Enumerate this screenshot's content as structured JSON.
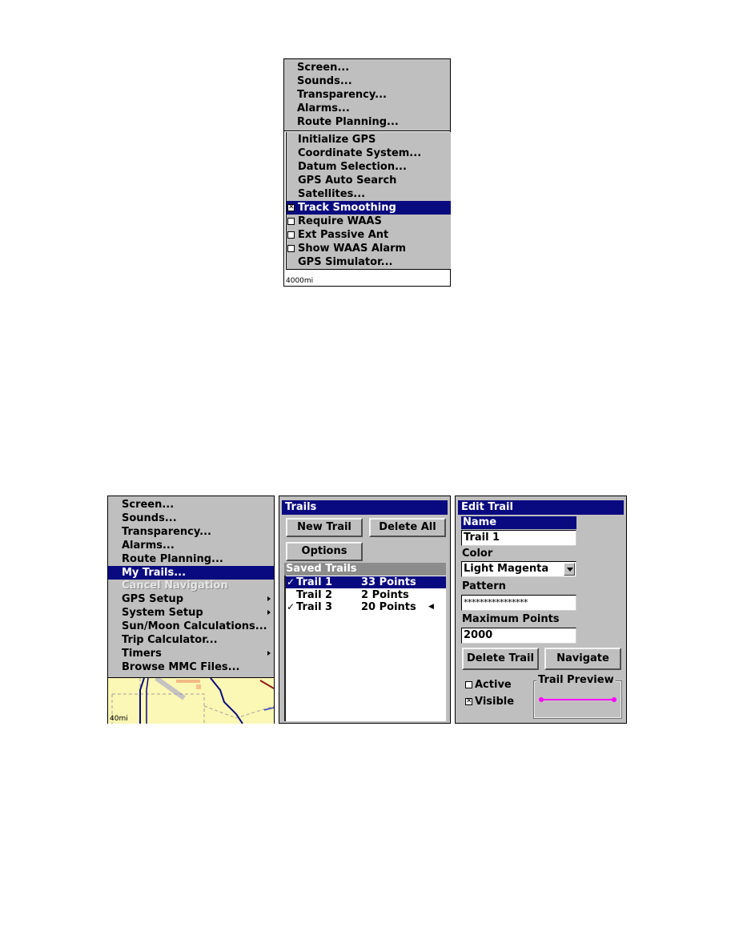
{
  "top_menu": {
    "items_group1": [
      {
        "label": "Screen..."
      },
      {
        "label": "Sounds..."
      },
      {
        "label": "Transparency..."
      },
      {
        "label": "Alarms..."
      },
      {
        "label": "Route Planning..."
      }
    ],
    "items_group2": [
      {
        "label": "Initialize GPS",
        "checkbox": null,
        "selected": false
      },
      {
        "label": "Coordinate System...",
        "checkbox": null,
        "selected": false
      },
      {
        "label": "Datum Selection...",
        "checkbox": null,
        "selected": false
      },
      {
        "label": "GPS Auto Search",
        "checkbox": null,
        "selected": false
      },
      {
        "label": "Satellites...",
        "checkbox": null,
        "selected": false
      },
      {
        "label": "Track Smoothing",
        "checkbox": true,
        "selected": true
      },
      {
        "label": "Require WAAS",
        "checkbox": false,
        "selected": false
      },
      {
        "label": "Ext Passive Ant",
        "checkbox": false,
        "selected": false
      },
      {
        "label": "Show WAAS Alarm",
        "checkbox": false,
        "selected": false
      },
      {
        "label": "GPS Simulator...",
        "checkbox": null,
        "selected": false
      }
    ],
    "scale": "4000mi"
  },
  "main_menu": {
    "items": [
      {
        "label": "Screen...",
        "selected": false,
        "disabled": false,
        "submenu": false
      },
      {
        "label": "Sounds...",
        "selected": false,
        "disabled": false,
        "submenu": false
      },
      {
        "label": "Transparency...",
        "selected": false,
        "disabled": false,
        "submenu": false
      },
      {
        "label": "Alarms...",
        "selected": false,
        "disabled": false,
        "submenu": false
      },
      {
        "label": "Route Planning...",
        "selected": false,
        "disabled": false,
        "submenu": false
      },
      {
        "label": "My Trails...",
        "selected": true,
        "disabled": false,
        "submenu": false
      },
      {
        "label": "Cancel Navigation",
        "selected": false,
        "disabled": true,
        "submenu": false
      },
      {
        "label": "GPS Setup",
        "selected": false,
        "disabled": false,
        "submenu": true
      },
      {
        "label": "System Setup",
        "selected": false,
        "disabled": false,
        "submenu": true
      },
      {
        "label": "Sun/Moon Calculations...",
        "selected": false,
        "disabled": false,
        "submenu": false
      },
      {
        "label": "Trip Calculator...",
        "selected": false,
        "disabled": false,
        "submenu": false
      },
      {
        "label": "Timers",
        "selected": false,
        "disabled": false,
        "submenu": true
      },
      {
        "label": "Browse MMC Files...",
        "selected": false,
        "disabled": false,
        "submenu": false
      }
    ],
    "scale": "40mi"
  },
  "trails_dialog": {
    "title": "Trails",
    "new_trail_button": "New Trail",
    "delete_all_button": "Delete All",
    "options_button": "Options",
    "saved_trails_header": "Saved Trails",
    "trails": [
      {
        "name": "Trail 1",
        "points": "33 Points",
        "checked": true,
        "selected": true,
        "pointer": false
      },
      {
        "name": "Trail 2",
        "points": "2 Points",
        "checked": false,
        "selected": false,
        "pointer": false
      },
      {
        "name": "Trail 3",
        "points": "20 Points",
        "checked": true,
        "selected": false,
        "pointer": true
      }
    ]
  },
  "edit_trail": {
    "title": "Edit Trail",
    "name_label": "Name",
    "name_value": "Trail 1",
    "color_label": "Color",
    "color_value": "Light Magenta",
    "pattern_label": "Pattern",
    "pattern_value": "****************",
    "max_points_label": "Maximum Points",
    "max_points_value": "2000",
    "delete_trail_button": "Delete Trail",
    "navigate_button": "Navigate",
    "active_label": "Active",
    "active_checked": false,
    "visible_label": "Visible",
    "visible_checked": true,
    "preview_label": "Trail Preview",
    "preview_color": "#ff00ff"
  },
  "glyphs": {
    "checked_box": "✕",
    "checkmark": "✓",
    "pointer": "◀"
  }
}
